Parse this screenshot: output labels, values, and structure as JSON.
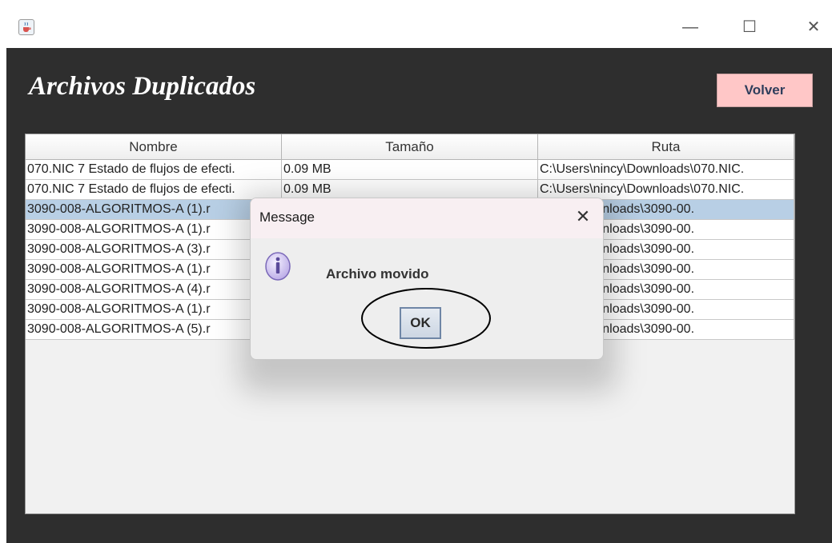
{
  "window": {
    "app_icon": "java-cup-icon",
    "controls": [
      "minimize-icon",
      "maximize-icon",
      "close-icon"
    ]
  },
  "header": {
    "title": "Archivos Duplicados",
    "back_button": "Volver"
  },
  "table": {
    "columns": [
      "Nombre",
      "Tamaño",
      "Ruta"
    ],
    "rows": [
      {
        "name": "070.NIC 7 Estado de flujos de efecti.",
        "size": "0.09 MB",
        "path": "C:\\Users\\nincy\\Downloads\\070.NIC.",
        "selected": false
      },
      {
        "name": "070.NIC 7 Estado de flujos de efecti.",
        "size": "0.09 MB",
        "path": "C:\\Users\\nincy\\Downloads\\070.NIC.",
        "selected": false
      },
      {
        "name": "3090-008-ALGORITMOS-A (1).r",
        "size": "",
        "path": "\\nincy\\Downloads\\3090-00.",
        "selected": true
      },
      {
        "name": "3090-008-ALGORITMOS-A (1).r",
        "size": "",
        "path": "\\nincy\\Downloads\\3090-00.",
        "selected": false
      },
      {
        "name": "3090-008-ALGORITMOS-A (3).r",
        "size": "",
        "path": "\\nincy\\Downloads\\3090-00.",
        "selected": false
      },
      {
        "name": "3090-008-ALGORITMOS-A (1).r",
        "size": "",
        "path": "\\nincy\\Downloads\\3090-00.",
        "selected": false
      },
      {
        "name": "3090-008-ALGORITMOS-A (4).r",
        "size": "",
        "path": "\\nincy\\Downloads\\3090-00.",
        "selected": false
      },
      {
        "name": "3090-008-ALGORITMOS-A (1).r",
        "size": "",
        "path": "\\nincy\\Downloads\\3090-00.",
        "selected": false
      },
      {
        "name": "3090-008-ALGORITMOS-A (5).r",
        "size": "",
        "path": "\\nincy\\Downloads\\3090-00.",
        "selected": false
      }
    ]
  },
  "dialog": {
    "title": "Message",
    "icon": "info-icon",
    "message": "Archivo movido",
    "ok_label": "OK"
  },
  "colors": {
    "background": "#2e2e2e",
    "volver_button": "#ffc7c7",
    "selected_row": "#b8cfe5",
    "title_text": "#ffffff"
  }
}
